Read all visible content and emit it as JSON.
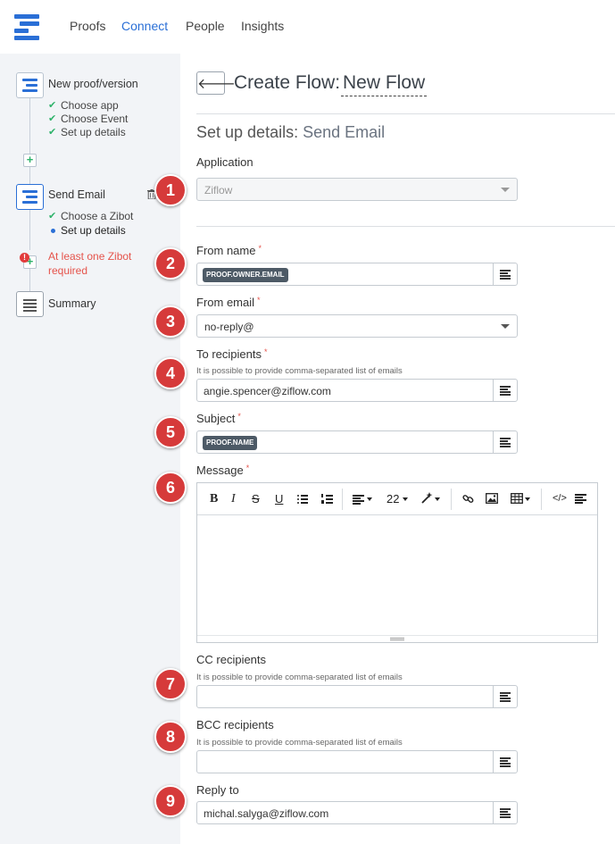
{
  "nav": {
    "items": [
      {
        "label": "Proofs",
        "active": false
      },
      {
        "label": "Connect",
        "active": true
      },
      {
        "label": "People",
        "active": false
      },
      {
        "label": "Insights",
        "active": false
      }
    ]
  },
  "sidebar": {
    "step1": {
      "title": "New proof/version",
      "subs": [
        "Choose app",
        "Choose Event",
        "Set up details"
      ]
    },
    "step2": {
      "title": "Send Email",
      "subs": [
        "Choose a Zibot",
        "Set up details"
      ]
    },
    "error": {
      "line1": "At least one Zibot",
      "line2": "required"
    },
    "step3": {
      "title": "Summary"
    }
  },
  "header": {
    "title": "Create Flow:",
    "flow_name": "New Flow"
  },
  "section": {
    "prefix": "Set up details:",
    "action": "Send Email"
  },
  "fields": {
    "application": {
      "label": "Application",
      "value": "Ziflow"
    },
    "from_name": {
      "label": "From name",
      "tag": "PROOF.OWNER.EMAIL"
    },
    "from_email": {
      "label": "From email",
      "value": "no-reply@"
    },
    "to_recipients": {
      "label": "To recipients",
      "help": "It is possible to provide comma-separated list of emails",
      "value": "angie.spencer@ziflow.com"
    },
    "subject": {
      "label": "Subject",
      "tag": "PROOF.NAME"
    },
    "message": {
      "label": "Message",
      "font_size": "22"
    },
    "cc_recipients": {
      "label": "CC recipients",
      "help": "It is possible to provide comma-separated list of emails",
      "value": ""
    },
    "bcc_recipients": {
      "label": "BCC recipients",
      "help": "It is possible to provide comma-separated list of emails",
      "value": ""
    },
    "reply_to": {
      "label": "Reply to",
      "value": "michal.salyga@ziflow.com"
    }
  },
  "required_mark": "*",
  "editor_toolbar": {
    "bold": "B",
    "italic": "I",
    "strike": "S",
    "underline": "U",
    "code": "</>"
  },
  "badges": [
    "1",
    "2",
    "3",
    "4",
    "5",
    "6",
    "7",
    "8",
    "9"
  ],
  "colors": {
    "accent": "#2a6fd6",
    "badge": "#d63a3a",
    "error": "#e5534b",
    "check": "#2fb36b",
    "tag": "#4d5a66"
  }
}
